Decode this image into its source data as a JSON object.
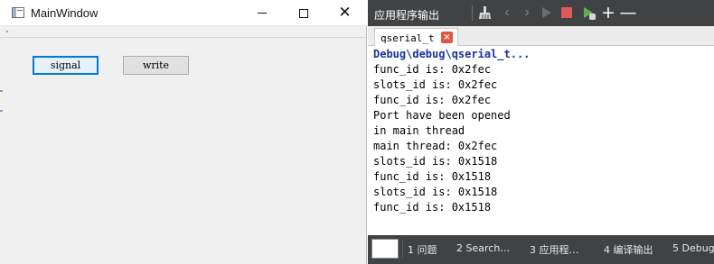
{
  "main_window": {
    "title": "MainWindow",
    "buttons": {
      "signal": "signal",
      "write": "write"
    }
  },
  "output_pane": {
    "title": "应用程序输出",
    "toolbar": {
      "icons": [
        "broom-icon",
        "chevron-left-icon",
        "chevron-right-icon",
        "run-icon",
        "stop-icon",
        "attach-debugger-icon",
        "plus-icon",
        "minus-icon"
      ],
      "plus": "+",
      "minus": "—",
      "prev": "‹",
      "next": "›",
      "stop_color": "#e05a5a",
      "attach_color": "#5fb04f"
    },
    "tab": {
      "label": "qserial_t",
      "close": "×"
    },
    "lines": [
      "Debug\\debug\\qserial_t...",
      "func_id is: 0x2fec",
      "slots_id is: 0x2fec",
      "func_id is: 0x2fec",
      "Port have been opened",
      "in main thread",
      "main thread: 0x2fec",
      "slots_id is: 0x1518",
      "func_id is: 0x1518",
      "slots_id is: 0x1518",
      "func_id is: 0x1518"
    ],
    "status_tabs": [
      "1 问题",
      "2 Search…",
      "3 应用程…",
      "4 编译输出",
      "5 Debug"
    ]
  }
}
